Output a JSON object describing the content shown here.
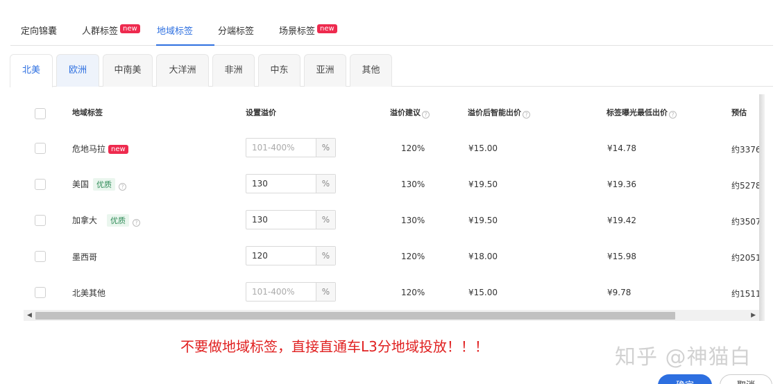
{
  "top_tabs": [
    {
      "label": "定向锦囊",
      "badge": ""
    },
    {
      "label": "人群标签",
      "badge": "new"
    },
    {
      "label": "地域标签",
      "badge": ""
    },
    {
      "label": "分端标签",
      "badge": ""
    },
    {
      "label": "场景标签",
      "badge": "new"
    }
  ],
  "region_tabs": [
    "北美",
    "欧洲",
    "中南美",
    "大洋洲",
    "非洲",
    "中东",
    "亚洲",
    "其他"
  ],
  "table": {
    "headers": {
      "region_tag": "地域标签",
      "set_premium": "设置溢价",
      "premium_advice": "溢价建议",
      "smart_bid": "溢价后智能出价",
      "min_bid": "标签曝光最低出价",
      "estimate": "预估"
    },
    "unit": "%",
    "rows": [
      {
        "name": "危地马拉",
        "badge": "new",
        "quality": "",
        "input_value": "",
        "placeholder": "101-400%",
        "advice": "120%",
        "smart_bid": "¥15.00",
        "min_bid": "¥14.78",
        "estimate": "约3376"
      },
      {
        "name": "美国",
        "badge": "",
        "quality": "优质",
        "input_value": "130",
        "placeholder": "101-400%",
        "advice": "130%",
        "smart_bid": "¥19.50",
        "min_bid": "¥19.36",
        "estimate": "约5278"
      },
      {
        "name": "加拿大",
        "badge": "",
        "quality": "优质",
        "input_value": "130",
        "placeholder": "101-400%",
        "advice": "130%",
        "smart_bid": "¥19.50",
        "min_bid": "¥19.42",
        "estimate": "约3507"
      },
      {
        "name": "墨西哥",
        "badge": "",
        "quality": "",
        "input_value": "120",
        "placeholder": "101-400%",
        "advice": "120%",
        "smart_bid": "¥18.00",
        "min_bid": "¥15.98",
        "estimate": "约2051"
      },
      {
        "name": "北美其他",
        "badge": "",
        "quality": "",
        "input_value": "",
        "placeholder": "101-400%",
        "advice": "120%",
        "smart_bid": "¥15.00",
        "min_bid": "¥9.78",
        "estimate": "约1511"
      }
    ]
  },
  "warning_text": "不要做地域标签，直接直通车L3分地域投放！！！",
  "watermark": "知乎 @神猫白",
  "buttons": {
    "confirm": "确定",
    "cancel": "取消"
  },
  "colors": {
    "accent": "#2d6fe0",
    "new_badge": "#ee2a4e",
    "warning": "#e02020"
  }
}
